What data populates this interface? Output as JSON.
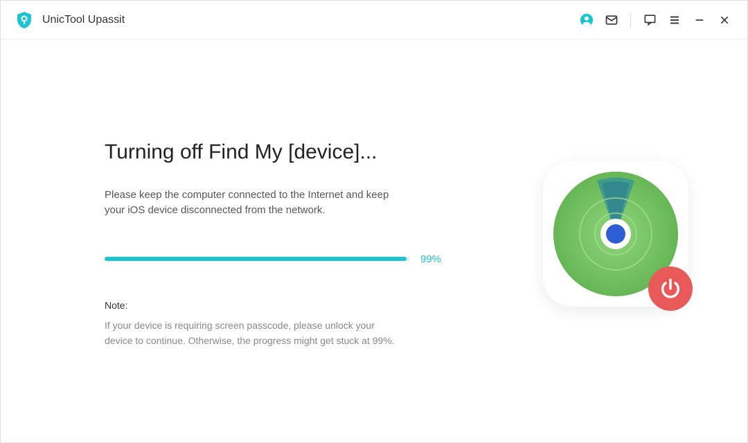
{
  "app": {
    "title": "UnicTool Upassit"
  },
  "main": {
    "heading": "Turning off Find My [device]...",
    "description": "Please keep the computer connected to the Internet and keep your iOS device disconnected from the network.",
    "progress_percent": 99,
    "progress_label": "99%",
    "note_label": "Note:",
    "note_text": "If your device is requiring screen passcode, please unlock your device to continue. Otherwise, the progress might get stuck at 99%."
  },
  "colors": {
    "accent": "#1cc4d4",
    "danger": "#e85a5a"
  }
}
